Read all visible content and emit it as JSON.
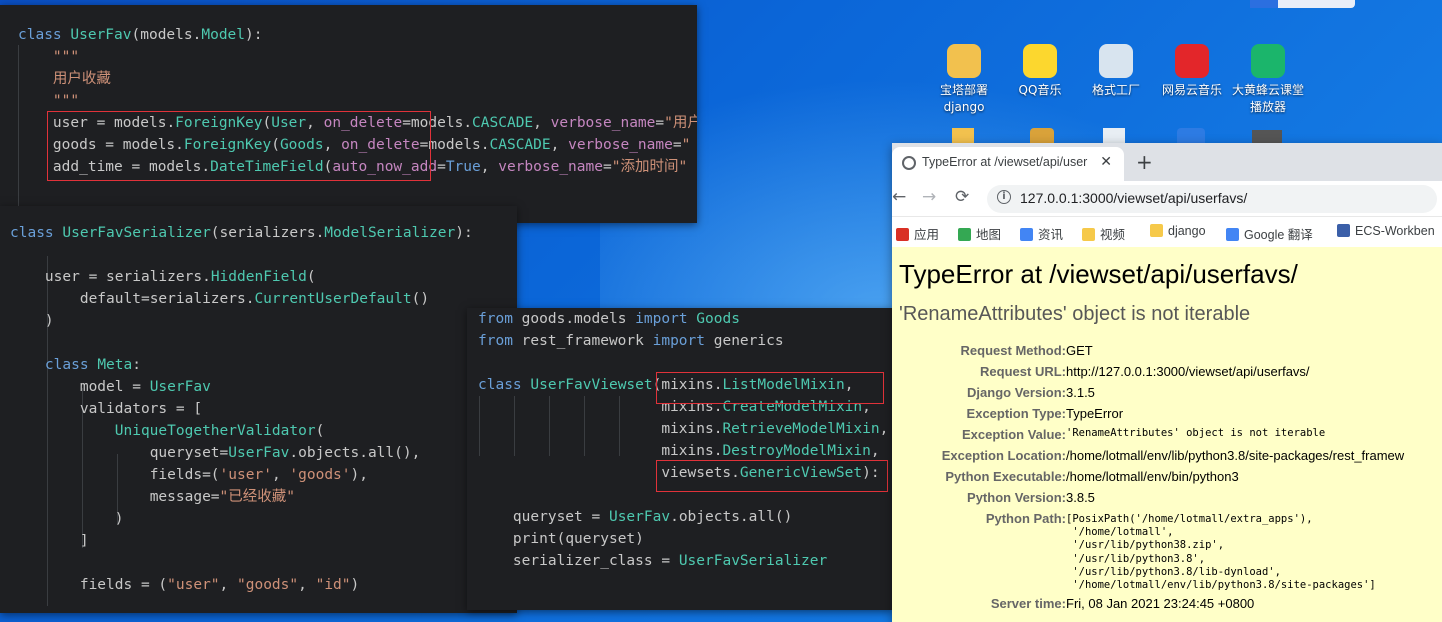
{
  "editor1": {
    "lines": [
      "class UserFav(models.Model):",
      "    \"\"\"",
      "    用户收藏",
      "    \"\"\"",
      "    user = models.ForeignKey(User, on_delete=models.CASCADE, verbose_name=\"用户\"",
      "    goods = models.ForeignKey(Goods, on_delete=models.CASCADE, verbose_name=\"",
      "    add_time = models.DateTimeField(auto_now_add=True, verbose_name=\"添加时间\""
    ]
  },
  "editor2": {
    "lines": [
      "class UserFavSerializer(serializers.ModelSerializer):",
      "",
      "    user = serializers.HiddenField(",
      "        default=serializers.CurrentUserDefault()",
      "    )",
      "",
      "    class Meta:",
      "        model = UserFav",
      "        validators = [",
      "            UniqueTogetherValidator(",
      "                queryset=UserFav.objects.all(),",
      "                fields=('user', 'goods'),",
      "                message=\"已经收藏\"",
      "            )",
      "        ]",
      "",
      "        fields = (\"user\", \"goods\", \"id\")"
    ]
  },
  "editor3": {
    "lines": [
      "from goods.models import Goods",
      "from rest_framework import generics",
      "",
      "class UserFavViewset(mixins.ListModelMixin,",
      "                     mixins.CreateModelMixin,",
      "                     mixins.RetrieveModelMixin,",
      "                     mixins.DestroyModelMixin,",
      "                     viewsets.GenericViewSet):",
      "",
      "    queryset = UserFav.objects.all()",
      "    print(queryset)",
      "    serializer_class = UserFavSerializer"
    ]
  },
  "desktop": {
    "icons": [
      {
        "label1": "宝塔部署",
        "label2": "django",
        "icon": "folder-icon",
        "color": "#f2c14e"
      },
      {
        "label1": "QQ音乐",
        "label2": "",
        "icon": "qq-music-icon",
        "color": "#fcd72e"
      },
      {
        "label1": "格式工厂",
        "label2": "",
        "icon": "format-factory-icon",
        "color": "#d8e4ef"
      },
      {
        "label1": "网易云音乐",
        "label2": "",
        "icon": "netease-music-icon",
        "color": "#e3262a"
      },
      {
        "label1": "大黄蜂云课堂",
        "label2": "播放器",
        "icon": "video-player-icon",
        "color": "#1bb56b"
      }
    ]
  },
  "browser": {
    "tab_title": "TypeError at /viewset/api/user",
    "tab_close": "✕",
    "new_tab": "+",
    "url": "127.0.0.1:3000/viewset/api/userfavs/",
    "bookmarks": [
      {
        "label": "应用",
        "icon": "apps-icon",
        "color": "#d93025"
      },
      {
        "label": "地图",
        "icon": "maps-icon",
        "color": "#34a853"
      },
      {
        "label": "资讯",
        "icon": "news-icon",
        "color": "#4285f4"
      },
      {
        "label": "视频",
        "icon": "folder-icon",
        "color": "#f6c94a"
      },
      {
        "label": "django",
        "icon": "folder-icon",
        "color": "#f6c94a"
      },
      {
        "label": "Google 翻译",
        "icon": "translate-icon",
        "color": "#4285f4"
      },
      {
        "label": "ECS-Workben",
        "icon": "ecs-icon",
        "color": "#3b5fa8"
      }
    ],
    "page": {
      "title": "TypeError at /viewset/api/userfavs/",
      "subtitle": "'RenameAttributes' object is not iterable",
      "meta": [
        {
          "k": "Request Method:",
          "v": "GET",
          "mono": false
        },
        {
          "k": "Request URL:",
          "v": "http://127.0.0.1:3000/viewset/api/userfavs/",
          "mono": false
        },
        {
          "k": "Django Version:",
          "v": "3.1.5",
          "mono": false
        },
        {
          "k": "Exception Type:",
          "v": "TypeError",
          "mono": false
        },
        {
          "k": "Exception Value:",
          "v": "'RenameAttributes' object is not iterable",
          "mono": true
        },
        {
          "k": "Exception Location:",
          "v": "/home/lotmall/env/lib/python3.8/site-packages/rest_framew",
          "mono": false
        },
        {
          "k": "Python Executable:",
          "v": "/home/lotmall/env/bin/python3",
          "mono": false
        },
        {
          "k": "Python Version:",
          "v": "3.8.5",
          "mono": false
        }
      ],
      "python_path_label": "Python Path:",
      "python_path": [
        "[PosixPath('/home/lotmall/extra_apps'),",
        " '/home/lotmall',",
        " '/usr/lib/python38.zip',",
        " '/usr/lib/python3.8',",
        " '/usr/lib/python3.8/lib-dynload',",
        " '/home/lotmall/env/lib/python3.8/site-packages']"
      ],
      "server_time_label": "Server time:",
      "server_time": "Fri, 08 Jan 2021 23:24:45 +0800"
    }
  }
}
